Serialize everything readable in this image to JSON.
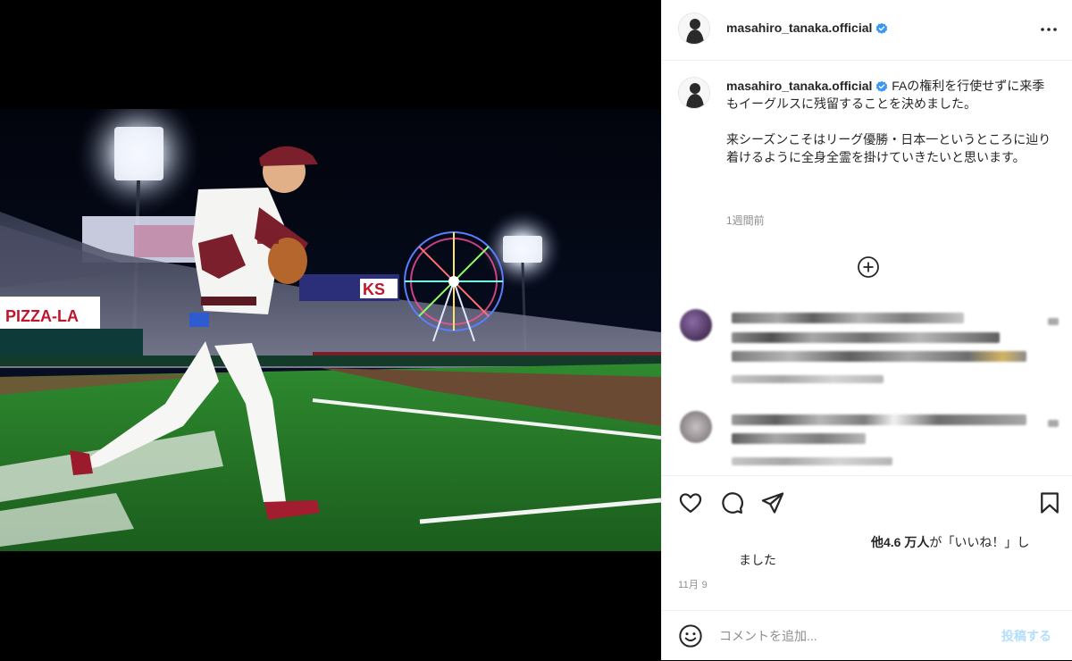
{
  "post": {
    "username": "masahiro_tanaka.official",
    "caption_p1": "FAの権利を行使せずに来季もイーグルスに残留することを決めました。",
    "caption_p2": "来シーズンこそはリーグ優勝・日本一というところに辿り着けるように全身全霊を掛けていきたいと思います。",
    "caption_time": "1週間前",
    "likes_prefix": "他",
    "likes_count": "4.6 万人",
    "likes_suffix": "が「いいね！」し",
    "likes_line2": "ました",
    "date": "11月 9"
  },
  "photo": {
    "banner_pizza": "PIZZA-LA",
    "banner_ks": "KS"
  },
  "comment_box": {
    "placeholder": "コメントを追加...",
    "post_label": "投稿する"
  },
  "colors": {
    "verified": "#3897f0",
    "post_button_disabled": "#b2dffc",
    "uniform_crimson": "#7a1f2b"
  },
  "icons": {
    "more": "more-horizontal-icon",
    "load_more": "plus-circle-icon",
    "like": "heart-icon",
    "comment": "comment-bubble-icon",
    "share": "paper-plane-icon",
    "save": "bookmark-icon",
    "emoji": "smiley-icon"
  }
}
